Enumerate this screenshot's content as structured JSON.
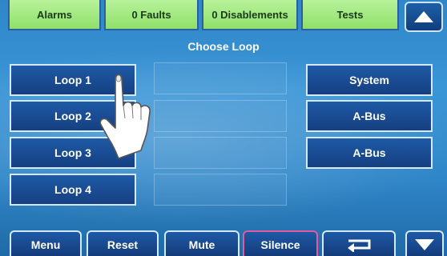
{
  "tabs": [
    {
      "label": "Alarms"
    },
    {
      "label": "0 Faults"
    },
    {
      "label": "0 Disablements"
    },
    {
      "label": "Tests"
    }
  ],
  "title": "Choose Loop",
  "loops": [
    {
      "label": "Loop 1"
    },
    {
      "label": "Loop 2"
    },
    {
      "label": "Loop 3"
    },
    {
      "label": "Loop 4"
    }
  ],
  "right_buttons": [
    {
      "label": "System"
    },
    {
      "label": "A-Bus"
    },
    {
      "label": "A-Bus"
    }
  ],
  "bottom": {
    "menu": "Menu",
    "reset": "Reset",
    "mute": "Mute",
    "silence": "Silence"
  },
  "icons": {
    "scroll_up": "chevron-up-icon",
    "scroll_down": "chevron-down-icon",
    "enter": "enter-return-icon",
    "pointer": "hand-pointer-icon"
  },
  "colors": {
    "tab_green": "#8ee06a",
    "button_blue": "#1e5aa6",
    "silence_border": "#e45aa0"
  }
}
